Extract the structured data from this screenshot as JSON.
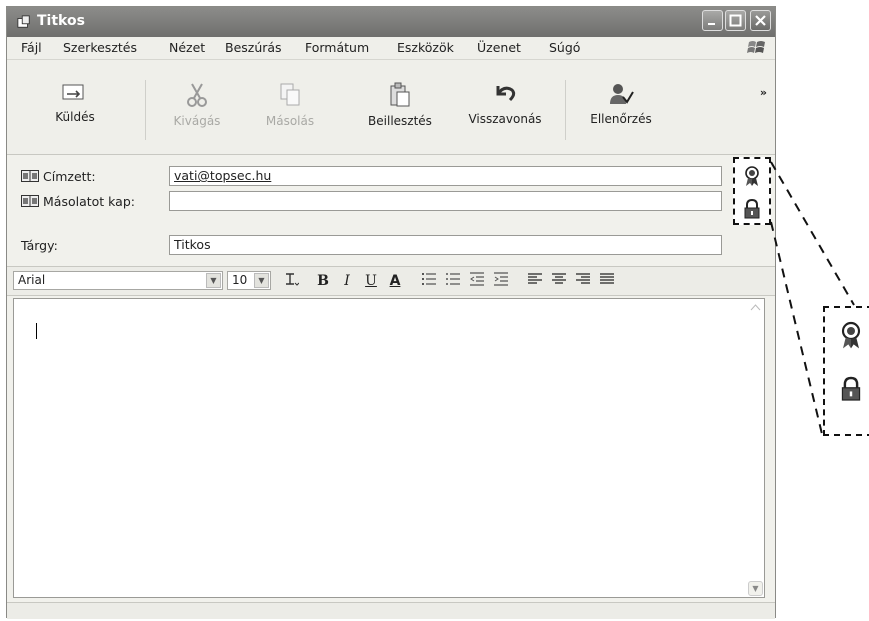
{
  "window": {
    "title": "Titkos"
  },
  "menu": {
    "items": [
      "Fájl",
      "Szerkesztés",
      "Nézet",
      "Beszúrás",
      "Formátum",
      "Eszközök",
      "Üzenet",
      "Súgó"
    ]
  },
  "toolbar": {
    "send": "Küldés",
    "cut": "Kivágás",
    "copy": "Másolás",
    "paste": "Beillesztés",
    "undo": "Visszavonás",
    "check": "Ellenőrzés"
  },
  "headers": {
    "to_label": "Címzett:",
    "to_value": "vati@topsec.hu",
    "cc_label": "Másolatot kap:",
    "cc_value": "",
    "subject_label": "Tárgy:",
    "subject_value": "Titkos"
  },
  "format": {
    "font": "Arial",
    "size": "10",
    "bold": "B",
    "italic": "I",
    "underline": "U",
    "font_color": "A"
  },
  "colors": {
    "titlebar": "#7d7d7b",
    "window_bg": "#f1f1ec"
  }
}
